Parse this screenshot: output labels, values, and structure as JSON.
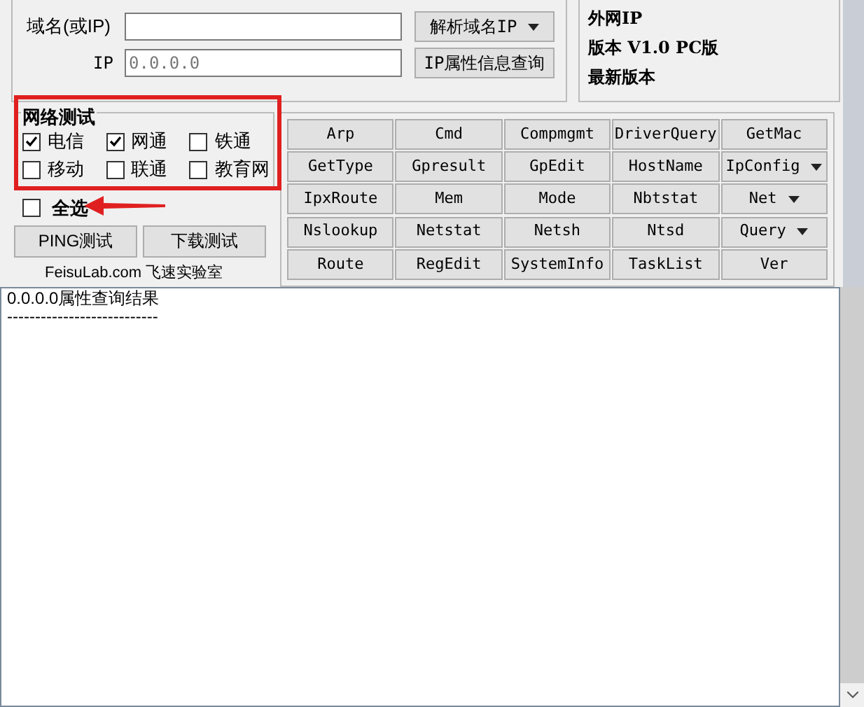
{
  "domain": {
    "label": "域名(或IP)"
  },
  "resolve_button": {
    "label": "解析域名IP",
    "menu": true
  },
  "ip": {
    "label": "IP",
    "value": "0.0.0.0"
  },
  "ip_query_button": {
    "label": "IP属性信息查询",
    "menu": false
  },
  "info": [
    "外网IP",
    "版本 V1.0 PC版",
    "最新版本"
  ],
  "network_test": {
    "title": "网络测试",
    "options": [
      {
        "label": "电信",
        "checked": true
      },
      {
        "label": "网通",
        "checked": true
      },
      {
        "label": "铁通",
        "checked": false
      },
      {
        "label": "移动",
        "checked": false
      },
      {
        "label": "联通",
        "checked": false
      },
      {
        "label": "教育网",
        "checked": false
      }
    ]
  },
  "select_all": {
    "label": "全选",
    "checked": false
  },
  "actions": [
    "PING测试",
    "下载测试"
  ],
  "credit": "FeisuLab.com 飞速实验室",
  "commands": [
    {
      "label": "Arp",
      "menu": false
    },
    {
      "label": "Cmd",
      "menu": false
    },
    {
      "label": "Compmgmt",
      "menu": false
    },
    {
      "label": "DriverQuery",
      "menu": false
    },
    {
      "label": "GetMac",
      "menu": false
    },
    {
      "label": "GetType",
      "menu": false
    },
    {
      "label": "Gpresult",
      "menu": false
    },
    {
      "label": "GpEdit",
      "menu": false
    },
    {
      "label": "HostName",
      "menu": false
    },
    {
      "label": "IpConfig",
      "menu": true
    },
    {
      "label": "IpxRoute",
      "menu": false
    },
    {
      "label": "Mem",
      "menu": false
    },
    {
      "label": "Mode",
      "menu": false
    },
    {
      "label": "Nbtstat",
      "menu": false
    },
    {
      "label": "Net",
      "menu": true
    },
    {
      "label": "Nslookup",
      "menu": false
    },
    {
      "label": "Netstat",
      "menu": false
    },
    {
      "label": "Netsh",
      "menu": false
    },
    {
      "label": "Ntsd",
      "menu": false
    },
    {
      "label": "Query",
      "menu": true
    },
    {
      "label": "Route",
      "menu": false
    },
    {
      "label": "RegEdit",
      "menu": false
    },
    {
      "label": "SystemInfo",
      "menu": false
    },
    {
      "label": "TaskList",
      "menu": false
    },
    {
      "label": "Ver",
      "menu": false
    }
  ],
  "result": [
    "0.0.0.0属性查询结果",
    "---------------------------"
  ]
}
